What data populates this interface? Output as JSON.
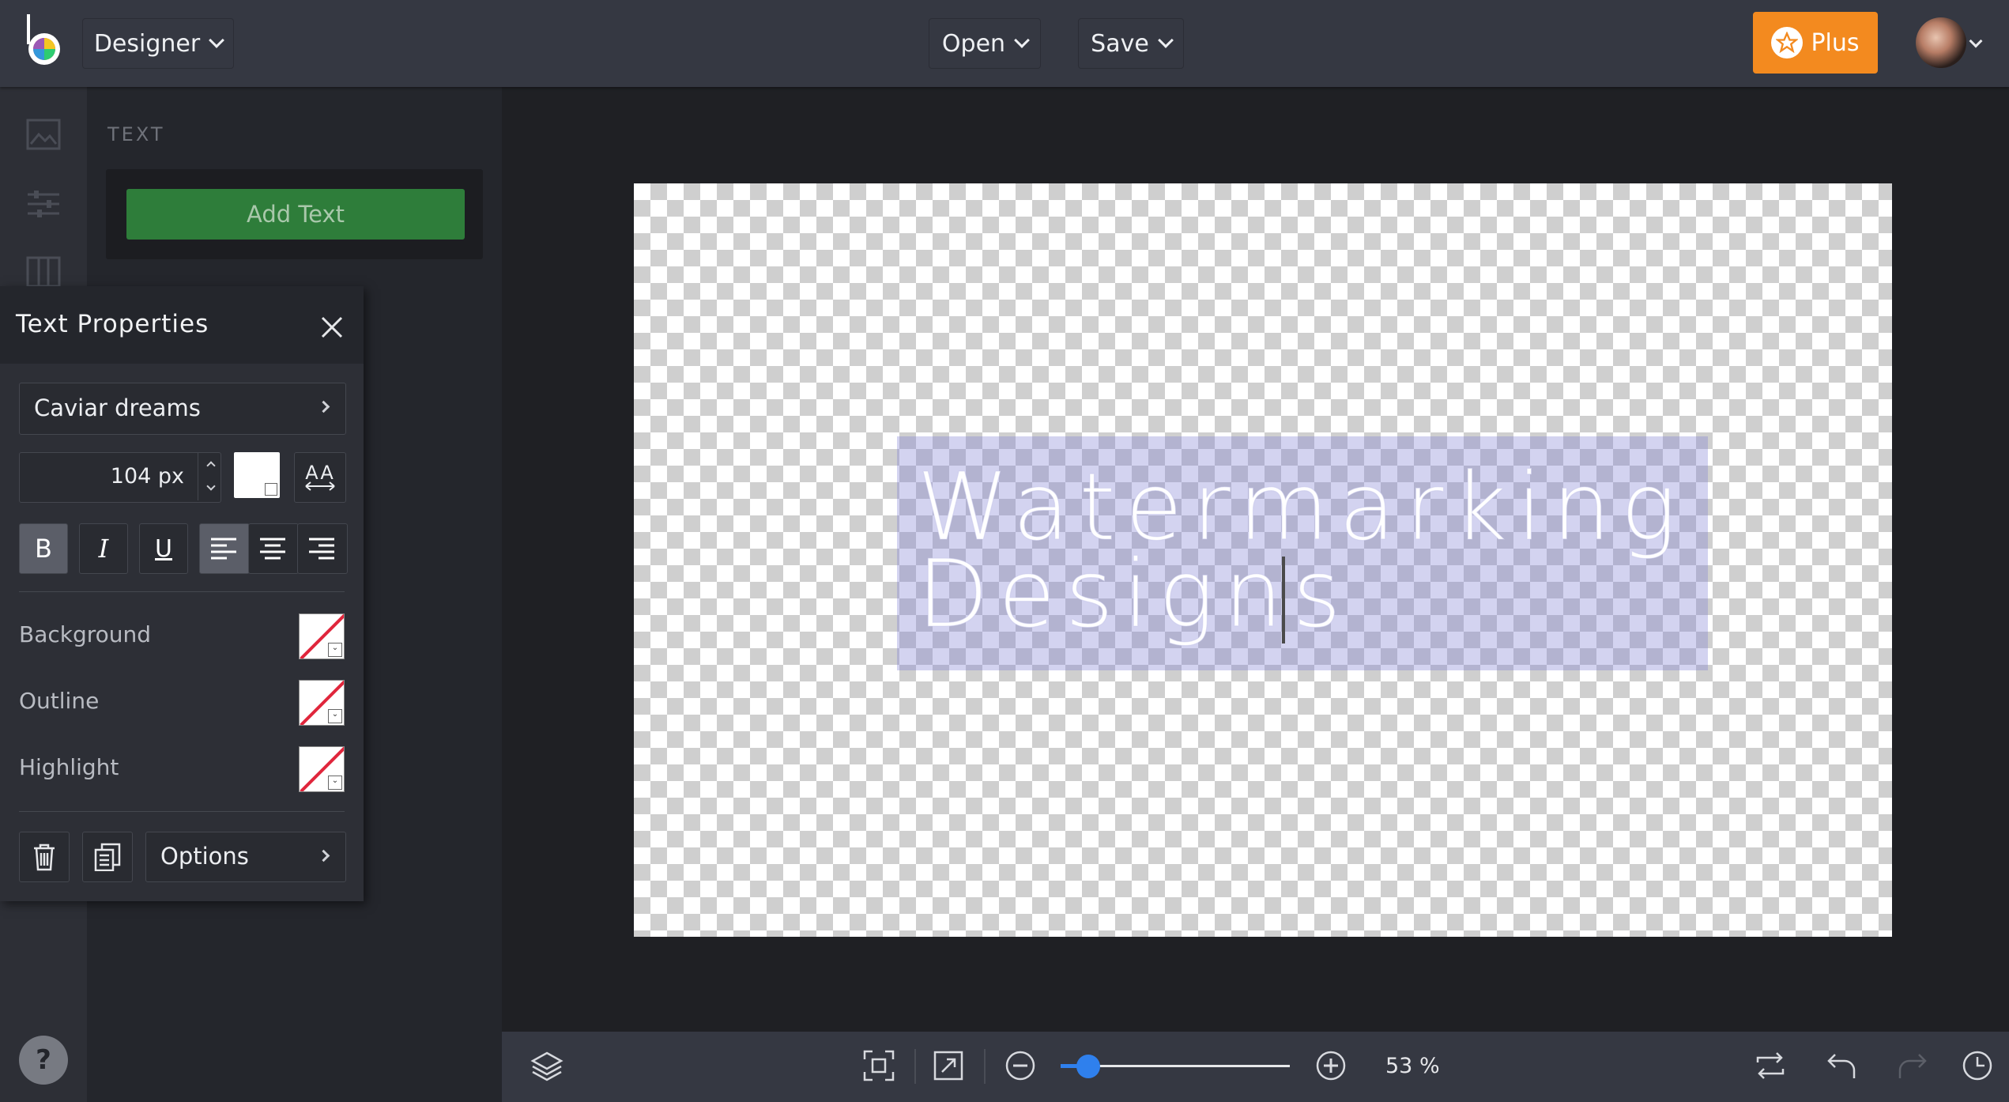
{
  "topbar": {
    "mode_label": "Designer",
    "open_label": "Open",
    "save_label": "Save",
    "plus_label": "Plus"
  },
  "panel": {
    "section_title": "TEXT",
    "add_text_label": "Add Text"
  },
  "text_properties": {
    "title": "Text Properties",
    "font_name": "Caviar dreams",
    "font_size": "104 px",
    "case_label": "AA",
    "bold_label": "B",
    "italic_label": "I",
    "underline_label": "U",
    "alignment": "left",
    "background_label": "Background",
    "outline_label": "Outline",
    "highlight_label": "Highlight",
    "options_label": "Options",
    "text_color": "#ffffff"
  },
  "canvas": {
    "text_line1": "Watermarking",
    "text_line2": "Designs"
  },
  "bottombar": {
    "zoom_percent": "53 %",
    "zoom_level": 0.12
  },
  "colors": {
    "accent_orange": "#f38a1f",
    "add_text_green": "#2e7d3a",
    "slider_blue": "#2f80ed"
  },
  "help_label": "?"
}
